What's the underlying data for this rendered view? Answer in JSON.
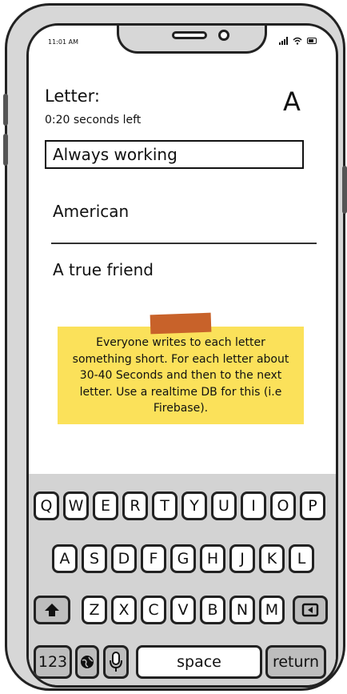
{
  "status_bar": {
    "time": "11:01 AM"
  },
  "header": {
    "label": "Letter:",
    "timer": "0:20 seconds left",
    "current_letter": "A"
  },
  "input": {
    "value": "Always working"
  },
  "answers": [
    "American",
    "A true friend"
  ],
  "note": {
    "text": "Everyone writes to each letter something short. For each letter about 30-40 Seconds and then to the next letter. Use a realtime DB for this (i.e Firebase)."
  },
  "keyboard": {
    "row1": [
      "Q",
      "W",
      "E",
      "R",
      "T",
      "Y",
      "U",
      "I",
      "O",
      "P"
    ],
    "row2": [
      "A",
      "S",
      "D",
      "F",
      "G",
      "H",
      "J",
      "K",
      "L"
    ],
    "row3": [
      "Z",
      "X",
      "C",
      "V",
      "B",
      "N",
      "M"
    ],
    "numbers_label": "123",
    "space_label": "space",
    "return_label": "return",
    "icons": {
      "shift": "shift-arrow-icon",
      "backspace": "backspace-icon",
      "globe": "globe-icon",
      "mic": "microphone-icon"
    }
  },
  "colors": {
    "note_bg": "#fbe15a",
    "tape": "#c8622a",
    "keyboard_bg": "#d3d3d3"
  }
}
